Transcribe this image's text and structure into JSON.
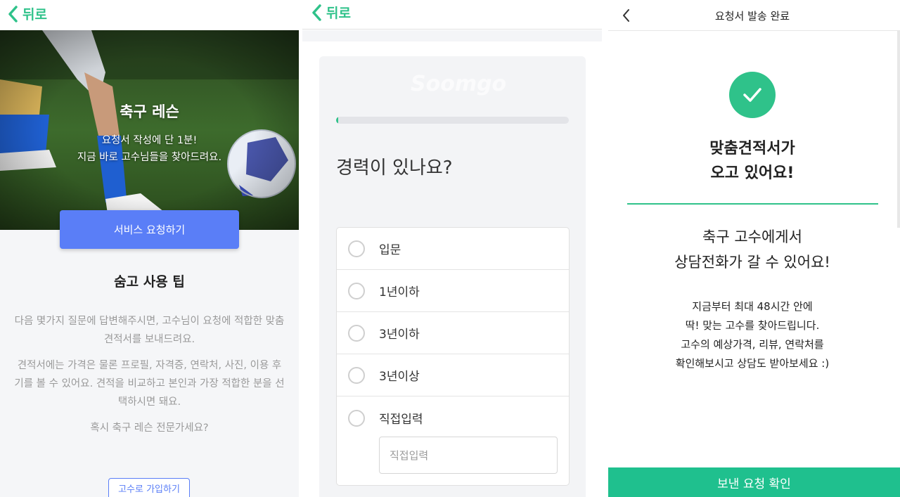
{
  "screen1": {
    "back_label": "뒤로",
    "hero_title": "축구 레슨",
    "hero_sub_line1": "요청서 작성에 단 1분!",
    "hero_sub_line2": "지금 바로 고수님들을 찾아드려요.",
    "request_button": "서비스 요청하기",
    "tips_title": "숨고 사용 팁",
    "tips_para1": "다음 몇가지 질문에 답변해주시면, 고수님이 요청에 적합한 맞춤 견적서를 보내드려요.",
    "tips_para2": "견적서에는 가격은 물론 프로필, 자격증, 연락처, 사진, 이용 후기를 볼 수 있어요. 견적을 비교하고 본인과 가장 적합한 분을 선택하시면 돼요.",
    "tips_para3": "혹시 축구 레슨 전문가세요?",
    "join_button": "고수로 가입하기"
  },
  "screen2": {
    "back_label": "뒤로",
    "watermark": "Soomgo",
    "progress_fraction": 0.01,
    "question": "경력이 있나요?",
    "options": [
      {
        "label": "입문"
      },
      {
        "label": "1년이하"
      },
      {
        "label": "3년이하"
      },
      {
        "label": "3년이상"
      },
      {
        "label": "직접입력"
      }
    ],
    "direct_input_placeholder": "직접입력"
  },
  "screen3": {
    "header_title": "요청서 발송 완료",
    "headline_line1": "맞춤견적서가",
    "headline_line2": "오고 있어요!",
    "sub_line1": "축구 고수에게서",
    "sub_line2": "상담전화가 갈 수 있어요!",
    "body_line1": "지금부터 최대 48시간 안에",
    "body_line2": "딱! 맞는 고수를 찾아드립니다.",
    "body_line3": "고수의 예상가격, 리뷰, 연락처를",
    "body_line4": "확인해보시고 상담도 받아보세요 :)",
    "confirm_button": "보낸 요청 확인"
  },
  "colors": {
    "brand_green": "#2fc28a",
    "confirm_green": "#1fc08e",
    "primary_blue": "#5a7ef7"
  },
  "icons": [
    "chevron-left-icon",
    "check-icon",
    "radio-unchecked-icon"
  ]
}
